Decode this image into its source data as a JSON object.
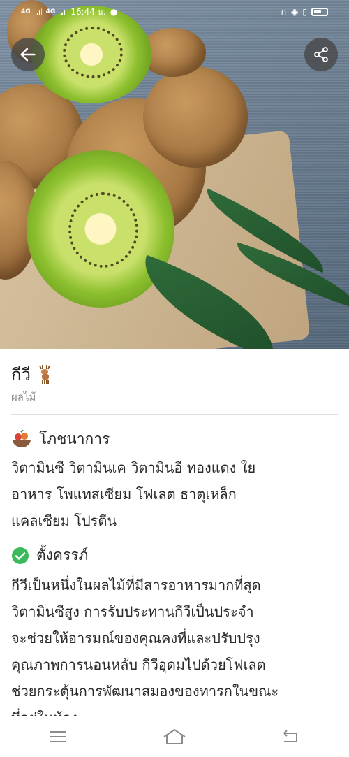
{
  "status_bar": {
    "network1": "4G",
    "network2": "4G",
    "time": "16:44 น."
  },
  "item": {
    "name": "กีวี",
    "category": "ผลไม้"
  },
  "nutrition": {
    "heading": "โภชนาการ",
    "lines": [
      "วิตามินซี วิตามินเค วิตามินอี ทองแดง ใย",
      "อาหาร โพแทสเซียม โฟเลต ธาตุเหล็ก",
      "แคลเซียม โปรตีน"
    ]
  },
  "pregnancy": {
    "heading": "ตั้งครรภ์",
    "lines": [
      "กีวีเป็นหนึ่งในผลไม้ที่มีสารอาหารมากที่สุด",
      "วิตามินซีสูง การรับประทานกีวีเป็นประจำ",
      "จะช่วยให้อารมณ์ของคุณคงที่และปรับปรุง",
      "คุณภาพการนอนหลับ กีวีอุดมไปด้วยโฟเลต",
      "ช่วยกระตุ้นการพัฒนาสมองของทารกในขณะ",
      "ที่อยู่ในท้อง"
    ]
  },
  "icons": {
    "back": "arrow-left-icon",
    "share": "share-icon",
    "deer": "deer-icon",
    "fruit_bowl": "fruit-bowl-icon",
    "check": "check-circle-icon",
    "menu": "menu-icon",
    "home": "home-icon",
    "back_nav": "back-nav-icon"
  },
  "colors": {
    "check_green": "#3cb95a",
    "subtitle_gray": "#8a8a8a",
    "divider": "#dedede"
  }
}
